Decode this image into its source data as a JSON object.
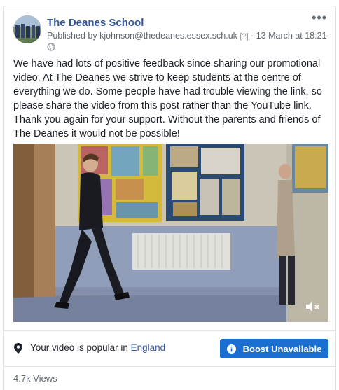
{
  "post": {
    "page_name": "The Deanes School",
    "published_by_prefix": "Published by ",
    "publisher": "kjohnson@thedeanes.essex.sch.uk",
    "help_marker": "[?]",
    "separator": " · ",
    "timestamp": "13 March at 18:21",
    "timestamp_suffix": " ·",
    "more_icon": "more-horizontal-icon",
    "privacy_icon": "globe-icon",
    "text": "We have had lots of positive feedback since sharing our promotional video. At The Deanes we strive to keep students at the centre of everything we do. Some people have had trouble viewing the link, so please share the video from this post rather than the YouTube link. Thank you again for your support. Without the parents and friends of The Deanes it would not be possible!"
  },
  "video": {
    "muted_icon": "speaker-muted-icon"
  },
  "promotion": {
    "popular_prefix": "Your video is popular in ",
    "region": "England",
    "pin_icon": "location-pin-icon",
    "boost_label": "Boost Unavailable",
    "boost_icon": "info-icon",
    "boost_color": "#1b6fd1"
  },
  "stats": {
    "views": "4.7k Views"
  },
  "colors": {
    "link": "#365899",
    "meta": "#616770",
    "text": "#1d2129"
  }
}
